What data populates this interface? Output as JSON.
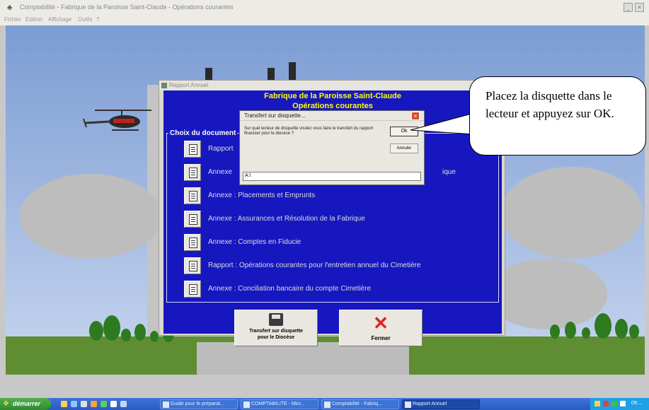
{
  "app": {
    "title": "Comptabilité - Fabrique de la Paroisse Saint-Claude - Opérations courantes",
    "menu": [
      "Fichier",
      "Edition",
      "Affichage",
      "Outils",
      "?"
    ]
  },
  "rapport_window": {
    "title": "Rapport Annuel",
    "heading_line1": "Fabrique de la Paroisse Saint-Claude",
    "heading_line2": "Opérations courantes",
    "group_label": "Choix du document",
    "documents": [
      "Rapport",
      "Annexe",
      "Annexe : Placements et Emprunts",
      "Annexe : Assurances et Résolution de la Fabrique",
      "Annexe : Comptes en Fiducie",
      "Rapport : Opérations courantes pour l'entretien annuel du Cimetière",
      "Annexe : Conciliation bancaire du compte Cimetière"
    ],
    "partial_suffix": "ique",
    "transfer_button_line1": "Transfert sur disquette",
    "transfer_button_line2": "pour le Diocèse",
    "close_button": "Fermer"
  },
  "transfer_dialog": {
    "title": "Transfert sur disquette...",
    "prompt": "Sur quel lecteur de disquette voulez vous faire le transfert du rapport financier pour le diocèse ?",
    "ok_label": "Ok",
    "cancel_label": "Annuler",
    "drive_value": "A:\\"
  },
  "callout": {
    "text": "Placez la disquette dans le lecteur et appuyez sur OK."
  },
  "taskbar": {
    "start_label": "démarrer",
    "windows": [
      {
        "label": "Guide pour le préparat...",
        "active": false
      },
      {
        "label": "COMPTABILITE - Micr...",
        "active": false
      },
      {
        "label": "Comptabilité - Fabriq...",
        "active": false
      },
      {
        "label": "Rapport Annuel",
        "active": true
      }
    ],
    "tray_time": "09:..."
  },
  "colors": {
    "dialog_blue": "#1717c0",
    "heading_yellow": "#ffff00",
    "taskbar_blue": "#2a5bc4",
    "start_green": "#2f8a2f"
  }
}
